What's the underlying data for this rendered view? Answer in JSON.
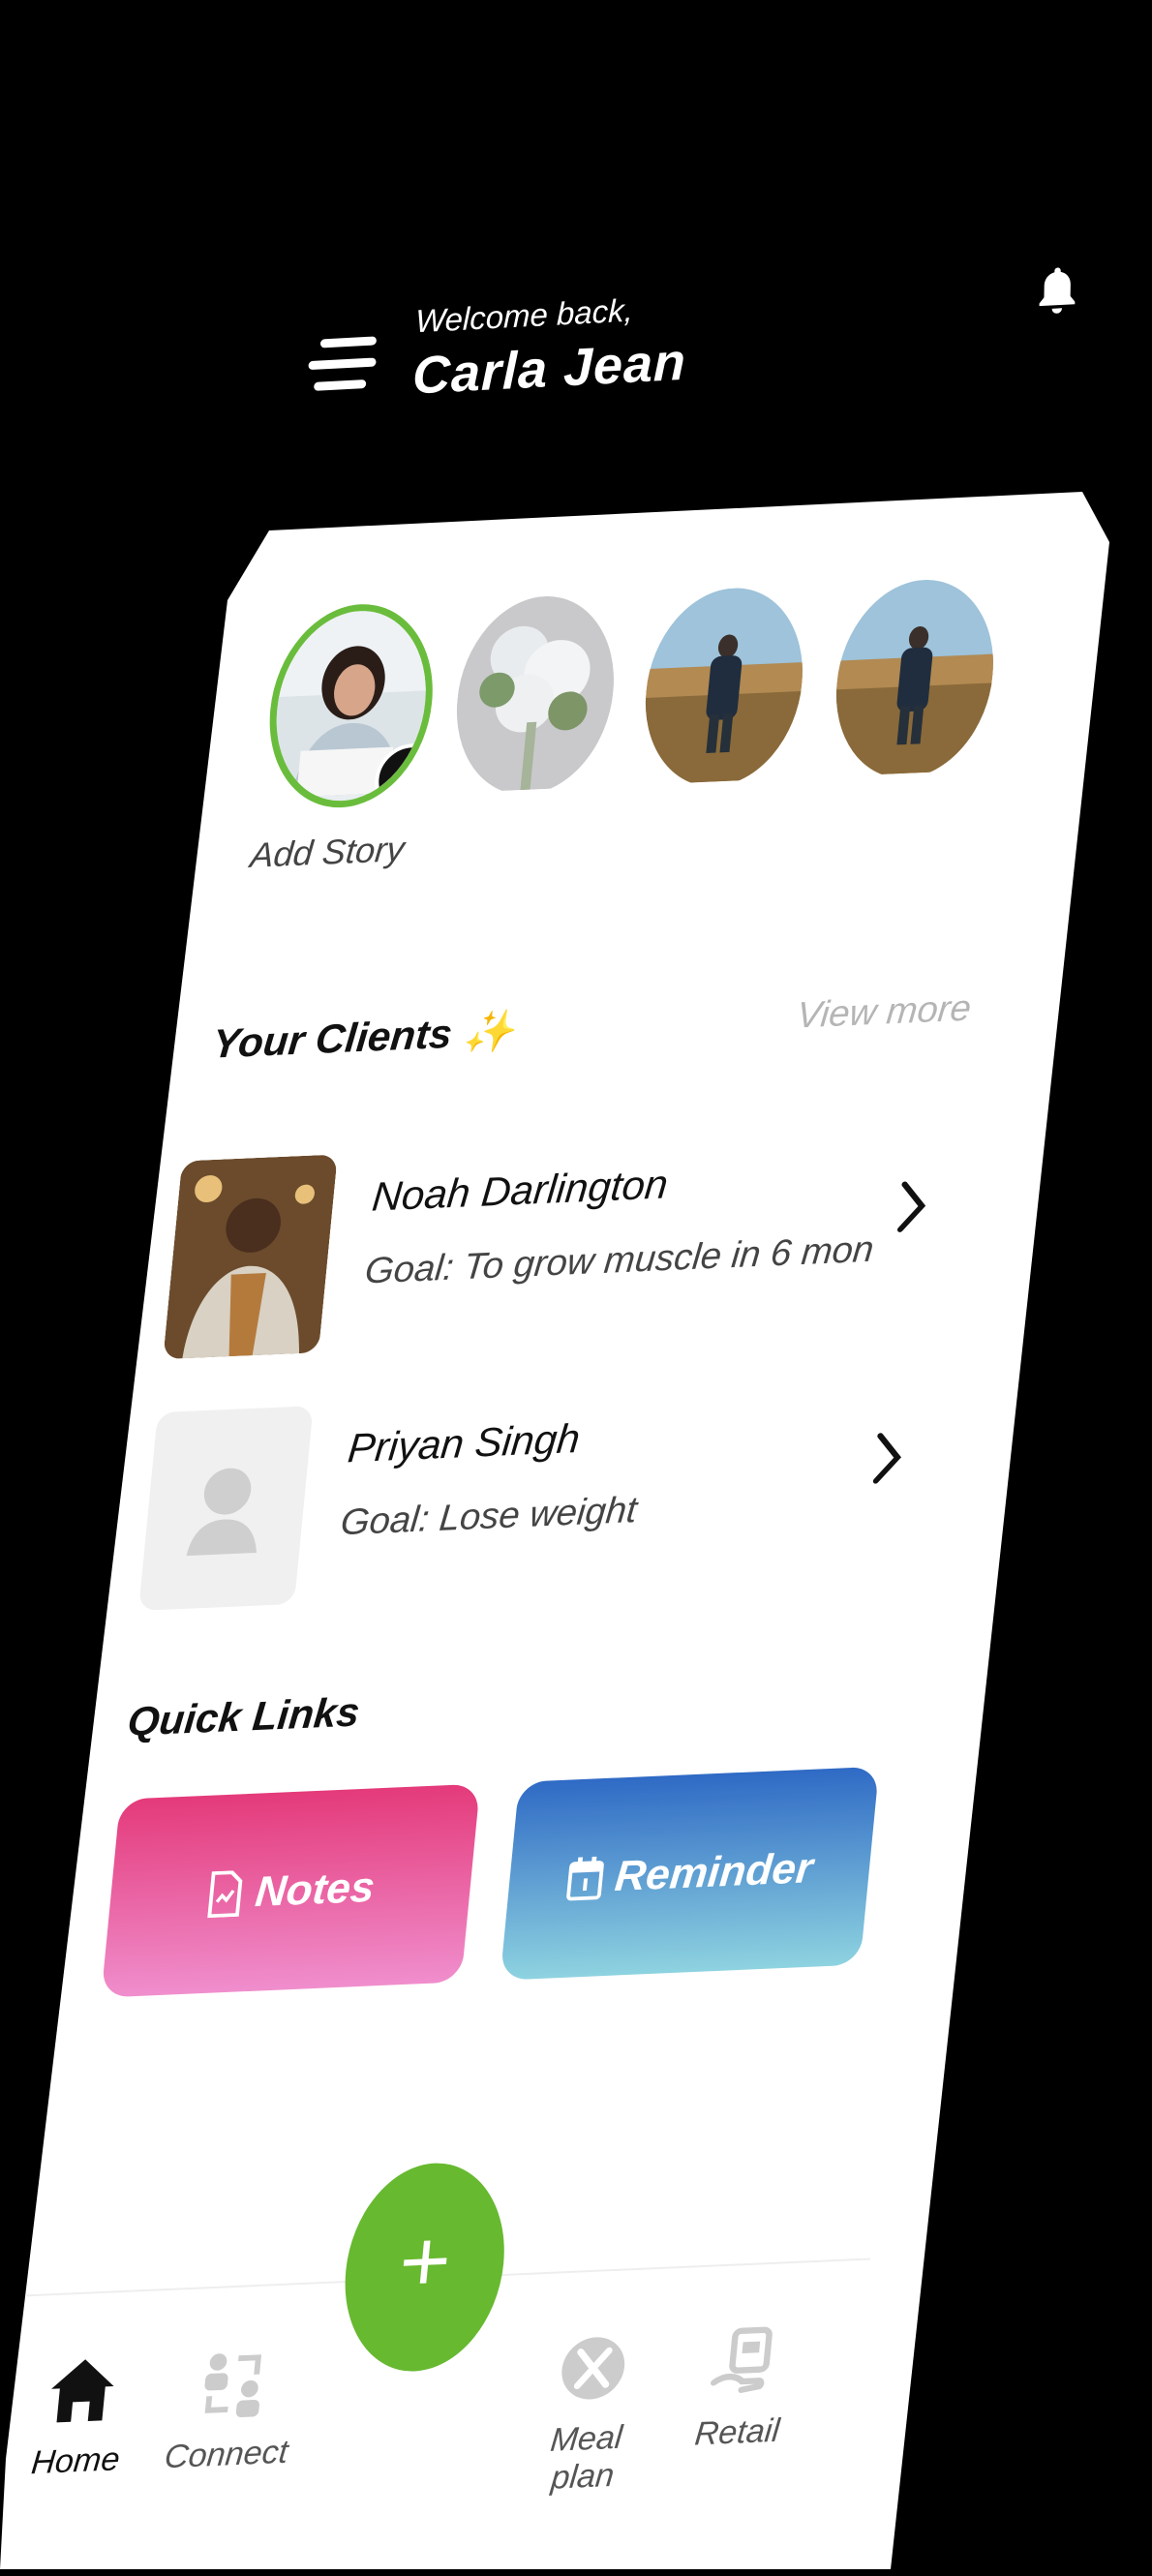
{
  "header": {
    "greeting": "Welcome back,",
    "user_name": "Carla Jean",
    "menu_icon": "hamburger-menu-icon",
    "bell_icon": "bell-icon"
  },
  "stories": {
    "add_story_label": "Add Story",
    "items": [
      {
        "kind": "own",
        "image": "woman-portrait"
      },
      {
        "kind": "story",
        "image": "white-flowers"
      },
      {
        "kind": "story",
        "image": "person-in-field"
      },
      {
        "kind": "story",
        "image": "person-in-field"
      }
    ]
  },
  "clients": {
    "title": "Your Clients ✨",
    "view_more": "View more",
    "items": [
      {
        "name": "Noah Darlington",
        "goal": "Goal: To grow muscle in 6 mon"
      },
      {
        "name": "Priyan Singh",
        "goal": "Goal: Lose weight"
      }
    ]
  },
  "quick_links": {
    "title": "Quick Links",
    "items": [
      {
        "label": "Notes",
        "icon": "notes-icon"
      },
      {
        "label": "Reminder",
        "icon": "calendar-icon"
      }
    ]
  },
  "bottom_nav": {
    "items": [
      {
        "label": "Home",
        "icon": "home-icon",
        "active": true
      },
      {
        "label": "Connect",
        "icon": "connect-icon",
        "active": false
      },
      {
        "label": "Meal plan",
        "icon": "meal-plan-icon",
        "active": false
      },
      {
        "label": "Retail",
        "icon": "retail-icon",
        "active": false
      }
    ],
    "fab_icon": "plus-icon"
  },
  "colors": {
    "accent_green": "#67b930",
    "notes_gradient": [
      "#e43a7a",
      "#f08ecd"
    ],
    "reminder_gradient": [
      "#2f6ac5",
      "#8ed3e0"
    ],
    "background": "#000000",
    "card": "#ffffff"
  }
}
